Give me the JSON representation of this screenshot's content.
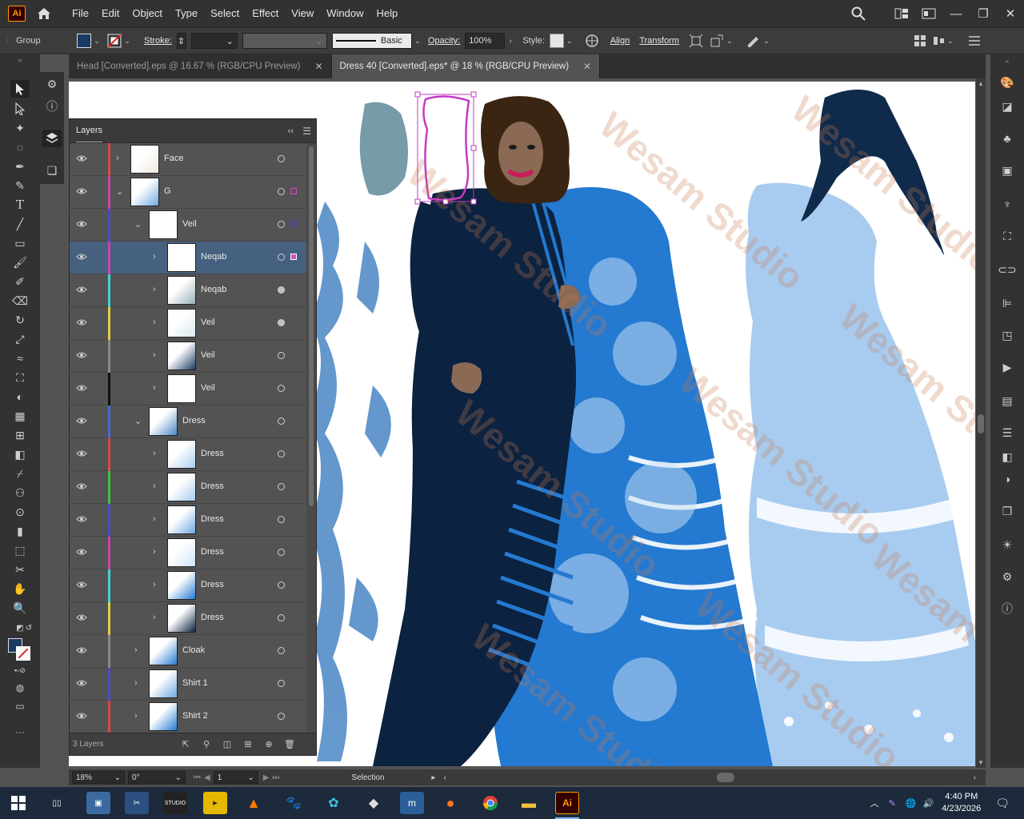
{
  "app": {
    "logo": "Ai",
    "menu": [
      "File",
      "Edit",
      "Object",
      "Type",
      "Select",
      "Effect",
      "View",
      "Window",
      "Help"
    ]
  },
  "control_bar": {
    "selection_type": "Group",
    "stroke_label": "Stroke:",
    "brush_label": "Basic",
    "opacity_label": "Opacity:",
    "opacity_value": "100%",
    "style_label": "Style:",
    "align_label": "Align",
    "transform_label": "Transform",
    "fill_color": "#1b3a63"
  },
  "tabs": [
    {
      "label": "Head [Converted].eps @ 16.67 % (RGB/CPU Preview)",
      "active": false
    },
    {
      "label": "Dress 40 [Converted].eps* @ 18 % (RGB/CPU Preview)",
      "active": true
    }
  ],
  "layers_panel": {
    "title": "Layers",
    "footer_count": "3 Layers",
    "rows": [
      {
        "name": "Face",
        "indent": 0,
        "expanded": false,
        "color": "#e04646",
        "selected": false,
        "target_filled": false,
        "sel_color": ""
      },
      {
        "name": "G",
        "indent": 0,
        "expanded": true,
        "color": "#cc44aa",
        "selected": false,
        "target_filled": false,
        "sel_color": "#d050c8"
      },
      {
        "name": "Veil",
        "indent": 1,
        "expanded": true,
        "color": "#4a4ac8",
        "selected": false,
        "target_filled": false,
        "sel_color": "#4a4ac8"
      },
      {
        "name": "Neqab",
        "indent": 2,
        "expanded": false,
        "color": "#cc44aa",
        "selected": true,
        "target_filled": false,
        "sel_color": "#d050c8"
      },
      {
        "name": "Neqab",
        "indent": 2,
        "expanded": false,
        "color": "#3fd6d6",
        "selected": false,
        "target_filled": true,
        "sel_color": ""
      },
      {
        "name": "Veil",
        "indent": 2,
        "expanded": false,
        "color": "#e0d040",
        "selected": false,
        "target_filled": true,
        "sel_color": ""
      },
      {
        "name": "Veil",
        "indent": 2,
        "expanded": false,
        "color": "#888888",
        "selected": false,
        "target_filled": false,
        "sel_color": ""
      },
      {
        "name": "Veil",
        "indent": 2,
        "expanded": false,
        "color": "#111111",
        "selected": false,
        "target_filled": false,
        "sel_color": ""
      },
      {
        "name": "Dress",
        "indent": 1,
        "expanded": true,
        "color": "#4a6ad0",
        "selected": false,
        "target_filled": false,
        "sel_color": ""
      },
      {
        "name": "Dress",
        "indent": 2,
        "expanded": false,
        "color": "#e04646",
        "selected": false,
        "target_filled": false,
        "sel_color": ""
      },
      {
        "name": "Dress",
        "indent": 2,
        "expanded": false,
        "color": "#40c040",
        "selected": false,
        "target_filled": false,
        "sel_color": ""
      },
      {
        "name": "Dress",
        "indent": 2,
        "expanded": false,
        "color": "#4a4ac8",
        "selected": false,
        "target_filled": false,
        "sel_color": ""
      },
      {
        "name": "Dress",
        "indent": 2,
        "expanded": false,
        "color": "#cc44aa",
        "selected": false,
        "target_filled": false,
        "sel_color": ""
      },
      {
        "name": "Dress",
        "indent": 2,
        "expanded": false,
        "color": "#3fd6d6",
        "selected": false,
        "target_filled": false,
        "sel_color": ""
      },
      {
        "name": "Dress",
        "indent": 2,
        "expanded": false,
        "color": "#e0d040",
        "selected": false,
        "target_filled": false,
        "sel_color": ""
      },
      {
        "name": "Cloak",
        "indent": 1,
        "expanded": false,
        "color": "#888888",
        "selected": false,
        "target_filled": false,
        "sel_color": ""
      },
      {
        "name": "Shirt 1",
        "indent": 1,
        "expanded": false,
        "color": "#4a4ac8",
        "selected": false,
        "target_filled": false,
        "sel_color": ""
      },
      {
        "name": "Shirt 2",
        "indent": 1,
        "expanded": false,
        "color": "#e04646",
        "selected": false,
        "target_filled": false,
        "sel_color": ""
      }
    ]
  },
  "canvas": {
    "watermark": "Wesam Studio"
  },
  "status_bar": {
    "zoom": "18%",
    "rotation": "0°",
    "artboard": "1",
    "tool": "Selection"
  },
  "taskbar": {
    "time": "4:40 PM",
    "date": "4/23/2026",
    "apps": [
      "photos",
      "snipping",
      "studio",
      "player",
      "vlc",
      "gimp",
      "screen",
      "inkscape",
      "shop",
      "firefox",
      "chrome",
      "explorer",
      "illustrator"
    ]
  }
}
